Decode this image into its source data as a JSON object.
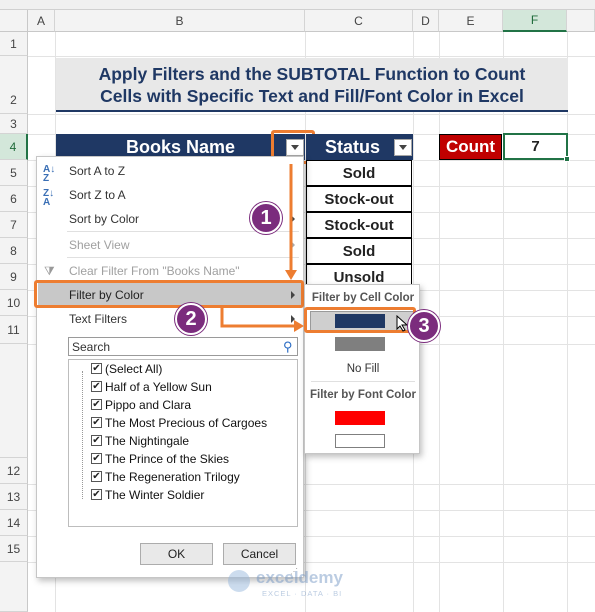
{
  "columns": [
    "A",
    "B",
    "C",
    "D",
    "E",
    "F"
  ],
  "rows_top": [
    "1",
    "2",
    "3",
    "4",
    "5",
    "6",
    "7",
    "8",
    "9",
    "10",
    "11"
  ],
  "rows_bottom": [
    "12",
    "13",
    "14",
    "15"
  ],
  "title": {
    "line1": "Apply Filters and the SUBTOTAL Function to Count",
    "line2": "Cells with Specific Text and Fill/Font Color in Excel"
  },
  "table": {
    "header_books": "Books Name",
    "header_status": "Status",
    "status_values": [
      "Sold",
      "Stock-out",
      "Stock-out",
      "Sold",
      "Unsold"
    ]
  },
  "count": {
    "label": "Count",
    "value": "7"
  },
  "filter_menu": {
    "sort_az": "Sort A to Z",
    "sort_za": "Sort Z to A",
    "sort_color": "Sort by Color",
    "sheet_view": "Sheet View",
    "clear_filter": "Clear Filter From \"Books Name\"",
    "filter_by_color": "Filter by Color",
    "text_filters": "Text Filters",
    "search_placeholder": "Search",
    "items": [
      "(Select All)",
      "Half of a Yellow Sun",
      "Pippo and Clara",
      "The Most Precious of Cargoes",
      "The Nightingale",
      "The Prince of the Skies",
      "The Regeneration Trilogy",
      "The Winter Soldier"
    ],
    "ok": "OK",
    "cancel": "Cancel"
  },
  "color_submenu": {
    "cell_color_title": "Filter by Cell Color",
    "no_fill": "No Fill",
    "font_color_title": "Filter by Font Color",
    "cell_colors": [
      "#1f3864",
      "#7f7f7f"
    ],
    "font_colors": [
      "#ff0000",
      "#ffffff"
    ]
  },
  "steps": [
    "1",
    "2",
    "3"
  ],
  "watermark": {
    "name": "exceldemy",
    "tagline": "EXCEL · DATA · BI"
  },
  "colors": {
    "header_navy": "#1f3864",
    "count_red": "#c00000",
    "callout_orange": "#ed7d31",
    "badge_purple": "#7b2c7d"
  }
}
